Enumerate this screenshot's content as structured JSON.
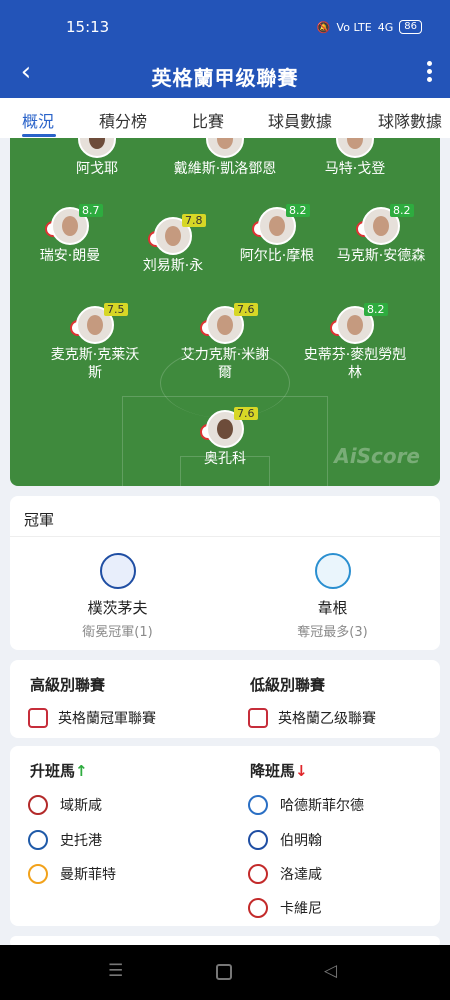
{
  "status_bar": {
    "time": "15:13",
    "signal": "4G",
    "volte": "Vo LTE",
    "battery": "86"
  },
  "header": {
    "title": "英格蘭甲级聯賽",
    "back_icon": "back-arrow-icon",
    "menu_icon": "more-vertical-icon"
  },
  "tabs": [
    {
      "label": "概況",
      "active": true
    },
    {
      "label": "積分榜",
      "active": false
    },
    {
      "label": "比賽",
      "active": false
    },
    {
      "label": "球員數據",
      "active": false
    },
    {
      "label": "球隊數據",
      "active": false
    }
  ],
  "pitch": {
    "watermark": "AiScore",
    "top_row": [
      {
        "name": "阿戈耶"
      },
      {
        "name": "戴維斯·凱洛鄧恩"
      },
      {
        "name": "马特·戈登"
      }
    ],
    "row2": [
      {
        "name": "瑞安·朗曼",
        "rating": "8.7",
        "green": true
      },
      {
        "name": "刘易斯·永",
        "rating": "7.8",
        "green": false
      },
      {
        "name": "阿尔比·摩根",
        "rating": "8.2",
        "green": true
      },
      {
        "name": "马克斯·安德森",
        "rating": "8.2",
        "green": true
      }
    ],
    "row3": [
      {
        "name": "麦克斯·克莱沃斯",
        "rating": "7.5",
        "green": false
      },
      {
        "name": "艾力克斯·米謝爾",
        "rating": "7.6",
        "green": false
      },
      {
        "name": "史蒂芬·麥剋勞剋林",
        "rating": "8.2",
        "green": true
      }
    ],
    "goalkeeper": {
      "name": "奥孔科",
      "rating": "7.6",
      "green": false
    }
  },
  "champions": {
    "title": "冠軍",
    "holder": {
      "team": "樸茨茅夫",
      "note": "衛冕冠軍(1)",
      "color": "#1f4ea3"
    },
    "most": {
      "team": "韋根",
      "note": "奪冠最多(3)",
      "color": "#2a8fd0"
    }
  },
  "leagues": {
    "higher_label": "高級別聯賽",
    "higher": "英格蘭冠軍聯賽",
    "lower_label": "低級別聯賽",
    "lower": "英格蘭乙级聯賽"
  },
  "movement": {
    "promoted_label": "升班馬",
    "promoted_arrow": "↑",
    "relegated_label": "降班馬",
    "relegated_arrow": "↓",
    "promoted": [
      {
        "team": "域斯咸",
        "color": "#b32a2a"
      },
      {
        "team": "史托港",
        "color": "#1f5aa8"
      },
      {
        "team": "曼斯菲特",
        "color": "#f2a21b"
      }
    ],
    "relegated": [
      {
        "team": "哈德斯菲尔德",
        "color": "#2a6fc4"
      },
      {
        "team": "伯明翰",
        "color": "#1f4ea3"
      },
      {
        "team": "洛達咸",
        "color": "#c32a2a"
      },
      {
        "team": "卡維尼",
        "color": "#c32a2a"
      }
    ]
  },
  "nav": {
    "menu_icon": "recent-apps-icon",
    "home_icon": "home-icon",
    "back_icon": "back-triangle-icon"
  }
}
